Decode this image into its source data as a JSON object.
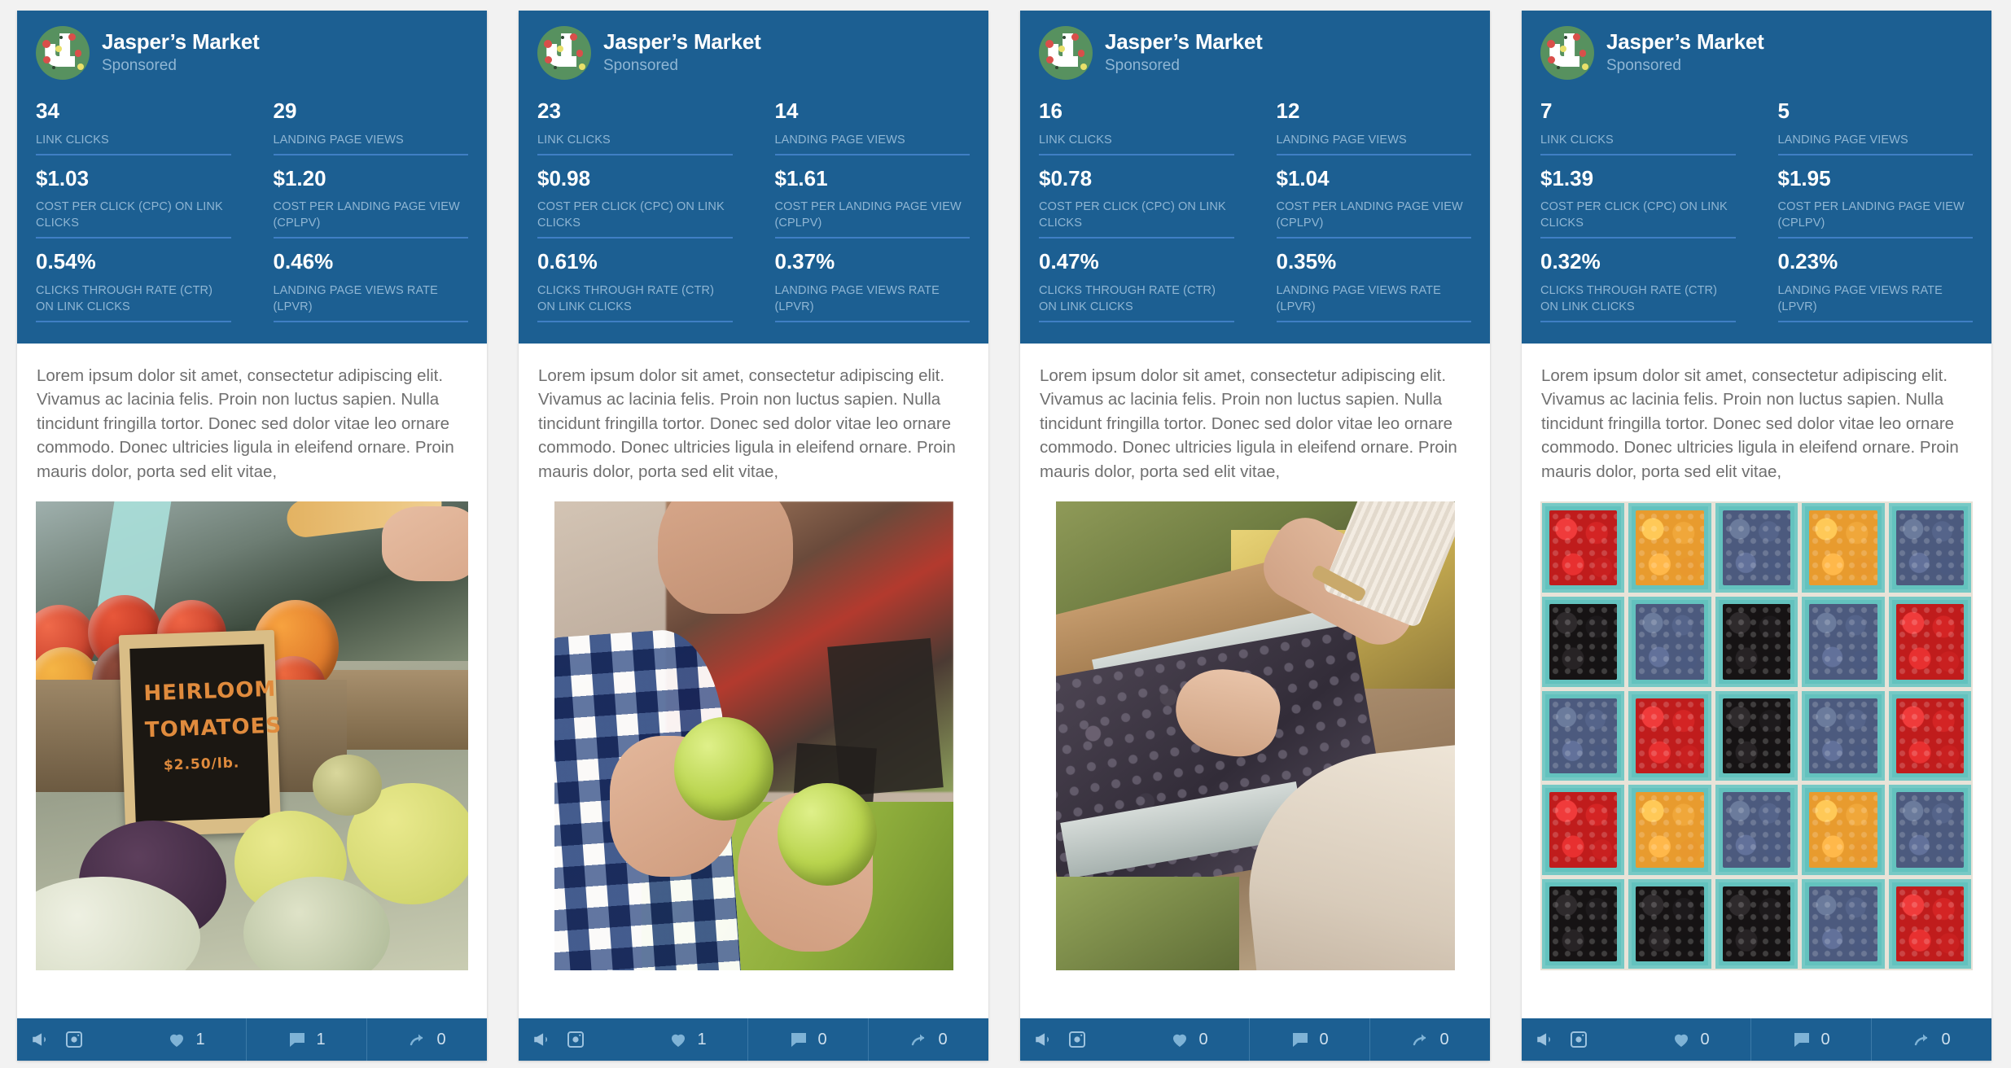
{
  "colors": {
    "panel_blue": "#1c5f92",
    "divider_blue": "#3f7fc4",
    "label_blue": "#8fb6d4",
    "page_bg": "#f2f2f2",
    "body_text": "#6f6f6f",
    "carton_teal": "#63c2be"
  },
  "brand": {
    "name": "Jasper’s Market",
    "sponsored": "Sponsored",
    "avatar_icon": "jaspers-market-logo"
  },
  "metric_labels": {
    "link_clicks": "LINK CLICKS",
    "landing_page_views": "LANDING PAGE VIEWS",
    "cpc": "COST PER CLICK (CPC) ON LINK CLICKS",
    "cplpv": "COST PER LANDING PAGE VIEW (CPLPV)",
    "ctr": "CLICKS THROUGH RATE (CTR) ON LINK CLICKS",
    "lpvr": "LANDING PAGE VIEWS RATE (LPVR)"
  },
  "body_text": "Lorem ipsum dolor sit amet, consectetur adipiscing elit. Vivamus ac lacinia felis. Proin non luctus sapien. Nulla tincidunt fringilla tortor. Donec sed dolor vitae leo ornare commodo. Donec ultricies ligula in eleifend ornare. Proin mauris dolor, porta sed elit vitae,",
  "footer_icons": {
    "ad": "megaphone-icon",
    "instagram": "instagram-icon",
    "like": "heart-icon",
    "comment": "comment-icon",
    "share": "share-icon"
  },
  "cards": [
    {
      "link_clicks": "34",
      "landing_page_views": "29",
      "cpc": "$1.03",
      "cplpv": "$1.20",
      "ctr": "0.54%",
      "lpvr": "0.46%",
      "likes": "1",
      "comments": "1",
      "shares": "0",
      "creative_alt": "farmers-market-heirloom-tomatoes",
      "sign_line1": "HEIRLOOM",
      "sign_line2": "TOMATOES",
      "sign_line3": "$2.50/lb."
    },
    {
      "link_clicks": "23",
      "landing_page_views": "14",
      "cpc": "$0.98",
      "cplpv": "$1.61",
      "ctr": "0.61%",
      "lpvr": "0.37%",
      "likes": "1",
      "comments": "0",
      "shares": "0",
      "creative_alt": "shopper-holding-green-apples"
    },
    {
      "link_clicks": "16",
      "landing_page_views": "12",
      "cpc": "$0.78",
      "cplpv": "$1.04",
      "ctr": "0.47%",
      "lpvr": "0.35%",
      "likes": "0",
      "comments": "0",
      "shares": "0",
      "creative_alt": "hand-selecting-grapes-at-market"
    },
    {
      "link_clicks": "7",
      "landing_page_views": "5",
      "cpc": "$1.39",
      "cplpv": "$1.95",
      "ctr": "0.32%",
      "lpvr": "0.23%",
      "likes": "0",
      "comments": "0",
      "shares": "0",
      "creative_alt": "berry-cartons-grid"
    }
  ],
  "berry_grid": [
    [
      "rasp",
      "gold",
      "blue",
      "gold",
      "blue"
    ],
    [
      "black",
      "blue",
      "black",
      "blue",
      "rasp"
    ],
    [
      "blue",
      "rasp",
      "black",
      "blue",
      "rasp"
    ],
    [
      "rasp",
      "gold",
      "blue",
      "gold",
      "blue"
    ],
    [
      "black",
      "black",
      "black",
      "blue",
      "rasp"
    ]
  ]
}
